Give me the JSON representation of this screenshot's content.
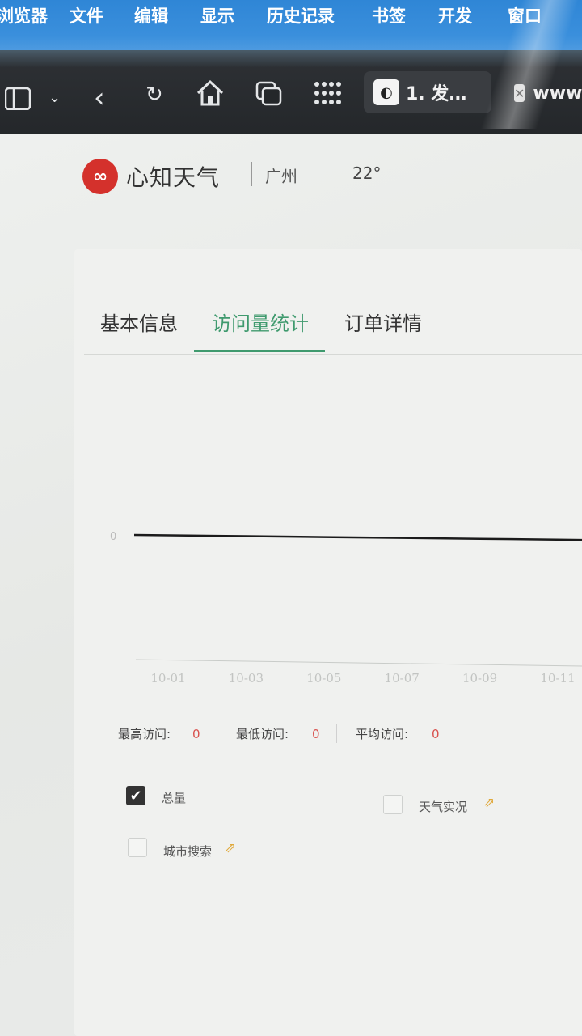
{
  "menubar": {
    "items": [
      "浏览器",
      "文件",
      "编辑",
      "显示",
      "历史记录",
      "书签",
      "开发",
      "窗口"
    ]
  },
  "browser": {
    "active_tab_title": "1. 发…",
    "second_tab_title": "www"
  },
  "header": {
    "brand": "心知天气",
    "city": "广州",
    "temperature": "22°"
  },
  "tabs": [
    "基本信息",
    "访问量统计",
    "订单详情"
  ],
  "active_tab_index": 1,
  "chart_data": {
    "type": "line",
    "y_tick_labels": [
      "0"
    ],
    "categories": [
      "10-01",
      "10-03",
      "10-05",
      "10-07",
      "10-09",
      "10-11"
    ],
    "series": [
      {
        "values": [
          0,
          0,
          0,
          0,
          0,
          0
        ]
      }
    ]
  },
  "stats": {
    "max_label": "最高访问:",
    "max_value": "0",
    "min_label": "最低访问:",
    "min_value": "0",
    "avg_label": "平均访问:",
    "avg_value": "0"
  },
  "checkboxes": [
    {
      "label": "总量",
      "checked": true
    },
    {
      "label": "天气实况",
      "checked": false
    },
    {
      "label": "城市搜索",
      "checked": false
    }
  ]
}
